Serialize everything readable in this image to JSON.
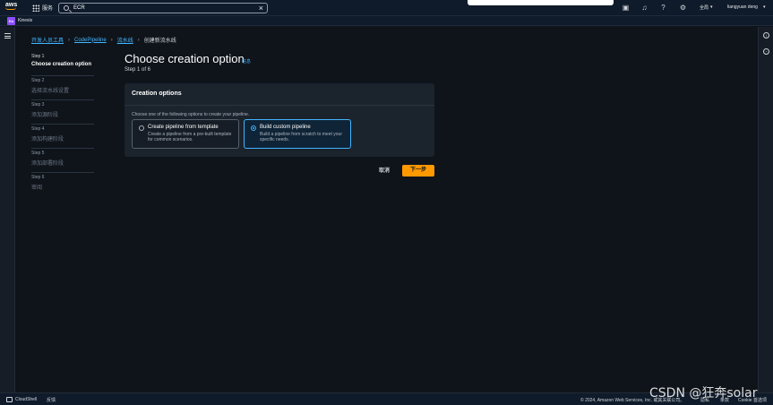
{
  "topnav": {
    "logo_text": "aws",
    "services_label": "服务",
    "search_value": "ECR",
    "clear_icon": "close-icon",
    "region_label": "全局",
    "user_label": "liangyuan deng"
  },
  "favbar": {
    "service_badge": "Ks",
    "service_label": "Kinesis"
  },
  "breadcrumb": {
    "items": [
      "开发人员工具",
      "CodePipeline",
      "流水线",
      "创建新流水线"
    ]
  },
  "steps": [
    {
      "num": "Step 1",
      "title": "Choose creation option"
    },
    {
      "num": "Step 2",
      "title": "选择流水线设置"
    },
    {
      "num": "Step 3",
      "title": "添加源阶段"
    },
    {
      "num": "Step 4",
      "title": "添加构建阶段"
    },
    {
      "num": "Step 5",
      "title": "添加部署阶段"
    },
    {
      "num": "Step 6",
      "title": "审阅"
    }
  ],
  "main": {
    "title": "Choose creation option",
    "info_link": "信息",
    "step_of": "Step 1 of 6",
    "panel_title": "Creation options",
    "panel_desc": "Choose one of the following options to create your pipeline.",
    "options": [
      {
        "title": "Create pipeline from template",
        "desc": "Create a pipeline from a pre-built template for common scenarios.",
        "selected": false
      },
      {
        "title": "Build custom pipeline",
        "desc": "Build a pipeline from scratch to meet your specific needs.",
        "selected": true
      }
    ],
    "cancel_label": "取消",
    "next_label": "下一步"
  },
  "footer": {
    "cloudshell": "CloudShell",
    "feedback": "反馈",
    "copyright": "© 2024, Amazon Web Services, Inc. 或其关联公司。",
    "privacy": "隐私",
    "terms": "条款",
    "cookies": "Cookie 首选项"
  },
  "watermark": "CSDN @狂奔solar",
  "colors": {
    "accent": "#42b4ff",
    "primary_button": "#ff9900",
    "background": "#0f141a"
  }
}
